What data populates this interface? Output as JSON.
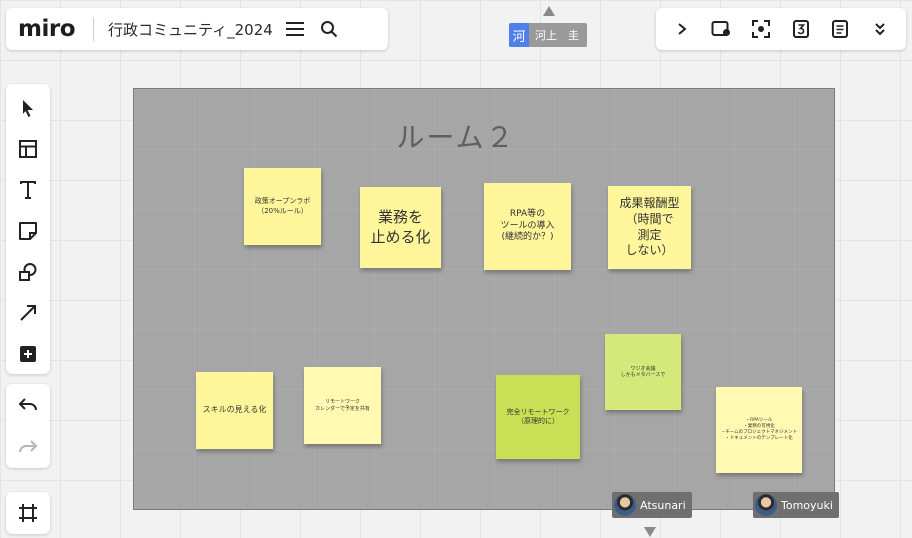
{
  "app": {
    "logo": "miro",
    "board_name": "行政コミュニティ_2024"
  },
  "collaborator_top": {
    "initial": "河",
    "name": "河上　圭"
  },
  "frame": {
    "title": "ルーム２",
    "stickies": [
      {
        "text": "政策オープンラボ\n（20%ルール）",
        "color": "yellow"
      },
      {
        "text": "業務を\n止める化",
        "color": "yellow"
      },
      {
        "text": "RPA等の\nツールの導入\n(継続的か？)",
        "color": "yellow"
      },
      {
        "text": "成果報酬型\n（時間で\n測定\nしない）",
        "color": "yellow"
      },
      {
        "text": "スキルの見える化",
        "color": "yellow"
      },
      {
        "text": "リモートワーク\nカレンダーで予定を共有",
        "color": "lyellow"
      },
      {
        "text": "完全リモートワーク\n（原理的に）",
        "color": "green"
      },
      {
        "text": "ワジオ会議\nしかもメタバースで",
        "color": "lgreen"
      },
      {
        "text": "・RPAツール\n・業務の可視化\n・チームのプロジェクトマネジメント\n・ドキュメントのテンプレート化",
        "color": "lyellow"
      }
    ]
  },
  "users": [
    {
      "name": "Atsunari"
    },
    {
      "name": "Tomoyuki"
    }
  ],
  "icons": {
    "menu": "hamburger-icon",
    "search": "search-icon",
    "top_right": [
      "chevron-right-icon",
      "share-screen-icon",
      "focus-icon",
      "timer-icon",
      "notes-icon",
      "double-chevron-down-icon"
    ],
    "left": [
      "select-cursor-icon",
      "templates-icon",
      "text-icon",
      "sticky-note-icon",
      "shapes-icon",
      "connector-arrow-icon",
      "add-more-icon"
    ],
    "undo": "undo-icon",
    "redo": "redo-icon",
    "frames": "frames-icon"
  },
  "colors": {
    "frame": "#a6a6a6",
    "sticky_yellow": "#fff59b",
    "sticky_green": "#c9df56",
    "collaborator": "#4f7fe8"
  }
}
